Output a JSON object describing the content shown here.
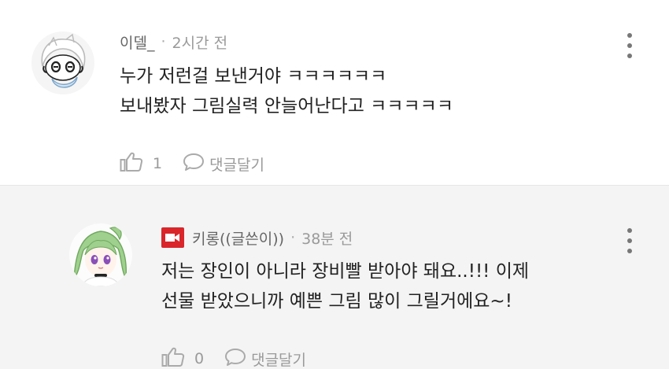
{
  "comments": [
    {
      "author": "이델_",
      "time": "2시간 전",
      "lines": [
        "누가 저런걸 보낸거야 ㅋㅋㅋㅋㅋㅋ",
        "보내봤자 그림실력 안늘어난다고 ㅋㅋㅋㅋㅋ"
      ],
      "likes": "1",
      "reply_label": "댓글달기"
    },
    {
      "author": "키롱((글쓴이))",
      "time": "38분 전",
      "lines": [
        "저는 장인이 아니라 장비빨 받아야 돼요..!!! 이제",
        "선물 받았으니까 예쁜 그림 많이 그릴거에요~!"
      ],
      "likes": "0",
      "reply_label": "댓글달기"
    }
  ],
  "colors": {
    "reply_background": "#f4f4f4",
    "badge_red": "#d9262b",
    "meta_gray": "#9a9a9a"
  },
  "icons": {
    "like": "thumbs-up-icon",
    "reply": "speech-bubble-icon",
    "more": "more-vertical-icon",
    "badge": "video-camera-icon"
  }
}
